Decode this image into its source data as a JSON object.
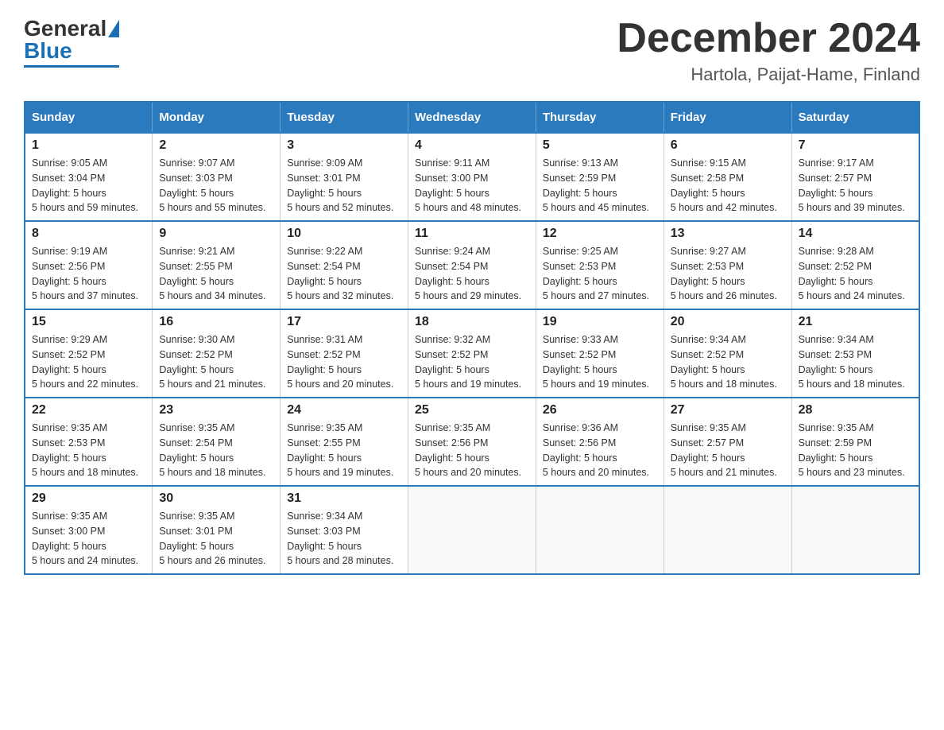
{
  "logo": {
    "general": "General",
    "blue": "Blue"
  },
  "title": "December 2024",
  "subtitle": "Hartola, Paijat-Hame, Finland",
  "days_of_week": [
    "Sunday",
    "Monday",
    "Tuesday",
    "Wednesday",
    "Thursday",
    "Friday",
    "Saturday"
  ],
  "weeks": [
    [
      {
        "day": "1",
        "sunrise": "9:05 AM",
        "sunset": "3:04 PM",
        "daylight": "5 hours and 59 minutes."
      },
      {
        "day": "2",
        "sunrise": "9:07 AM",
        "sunset": "3:03 PM",
        "daylight": "5 hours and 55 minutes."
      },
      {
        "day": "3",
        "sunrise": "9:09 AM",
        "sunset": "3:01 PM",
        "daylight": "5 hours and 52 minutes."
      },
      {
        "day": "4",
        "sunrise": "9:11 AM",
        "sunset": "3:00 PM",
        "daylight": "5 hours and 48 minutes."
      },
      {
        "day": "5",
        "sunrise": "9:13 AM",
        "sunset": "2:59 PM",
        "daylight": "5 hours and 45 minutes."
      },
      {
        "day": "6",
        "sunrise": "9:15 AM",
        "sunset": "2:58 PM",
        "daylight": "5 hours and 42 minutes."
      },
      {
        "day": "7",
        "sunrise": "9:17 AM",
        "sunset": "2:57 PM",
        "daylight": "5 hours and 39 minutes."
      }
    ],
    [
      {
        "day": "8",
        "sunrise": "9:19 AM",
        "sunset": "2:56 PM",
        "daylight": "5 hours and 37 minutes."
      },
      {
        "day": "9",
        "sunrise": "9:21 AM",
        "sunset": "2:55 PM",
        "daylight": "5 hours and 34 minutes."
      },
      {
        "day": "10",
        "sunrise": "9:22 AM",
        "sunset": "2:54 PM",
        "daylight": "5 hours and 32 minutes."
      },
      {
        "day": "11",
        "sunrise": "9:24 AM",
        "sunset": "2:54 PM",
        "daylight": "5 hours and 29 minutes."
      },
      {
        "day": "12",
        "sunrise": "9:25 AM",
        "sunset": "2:53 PM",
        "daylight": "5 hours and 27 minutes."
      },
      {
        "day": "13",
        "sunrise": "9:27 AM",
        "sunset": "2:53 PM",
        "daylight": "5 hours and 26 minutes."
      },
      {
        "day": "14",
        "sunrise": "9:28 AM",
        "sunset": "2:52 PM",
        "daylight": "5 hours and 24 minutes."
      }
    ],
    [
      {
        "day": "15",
        "sunrise": "9:29 AM",
        "sunset": "2:52 PM",
        "daylight": "5 hours and 22 minutes."
      },
      {
        "day": "16",
        "sunrise": "9:30 AM",
        "sunset": "2:52 PM",
        "daylight": "5 hours and 21 minutes."
      },
      {
        "day": "17",
        "sunrise": "9:31 AM",
        "sunset": "2:52 PM",
        "daylight": "5 hours and 20 minutes."
      },
      {
        "day": "18",
        "sunrise": "9:32 AM",
        "sunset": "2:52 PM",
        "daylight": "5 hours and 19 minutes."
      },
      {
        "day": "19",
        "sunrise": "9:33 AM",
        "sunset": "2:52 PM",
        "daylight": "5 hours and 19 minutes."
      },
      {
        "day": "20",
        "sunrise": "9:34 AM",
        "sunset": "2:52 PM",
        "daylight": "5 hours and 18 minutes."
      },
      {
        "day": "21",
        "sunrise": "9:34 AM",
        "sunset": "2:53 PM",
        "daylight": "5 hours and 18 minutes."
      }
    ],
    [
      {
        "day": "22",
        "sunrise": "9:35 AM",
        "sunset": "2:53 PM",
        "daylight": "5 hours and 18 minutes."
      },
      {
        "day": "23",
        "sunrise": "9:35 AM",
        "sunset": "2:54 PM",
        "daylight": "5 hours and 18 minutes."
      },
      {
        "day": "24",
        "sunrise": "9:35 AM",
        "sunset": "2:55 PM",
        "daylight": "5 hours and 19 minutes."
      },
      {
        "day": "25",
        "sunrise": "9:35 AM",
        "sunset": "2:56 PM",
        "daylight": "5 hours and 20 minutes."
      },
      {
        "day": "26",
        "sunrise": "9:36 AM",
        "sunset": "2:56 PM",
        "daylight": "5 hours and 20 minutes."
      },
      {
        "day": "27",
        "sunrise": "9:35 AM",
        "sunset": "2:57 PM",
        "daylight": "5 hours and 21 minutes."
      },
      {
        "day": "28",
        "sunrise": "9:35 AM",
        "sunset": "2:59 PM",
        "daylight": "5 hours and 23 minutes."
      }
    ],
    [
      {
        "day": "29",
        "sunrise": "9:35 AM",
        "sunset": "3:00 PM",
        "daylight": "5 hours and 24 minutes."
      },
      {
        "day": "30",
        "sunrise": "9:35 AM",
        "sunset": "3:01 PM",
        "daylight": "5 hours and 26 minutes."
      },
      {
        "day": "31",
        "sunrise": "9:34 AM",
        "sunset": "3:03 PM",
        "daylight": "5 hours and 28 minutes."
      },
      null,
      null,
      null,
      null
    ]
  ],
  "labels": {
    "sunrise": "Sunrise:",
    "sunset": "Sunset:",
    "daylight": "Daylight:"
  }
}
